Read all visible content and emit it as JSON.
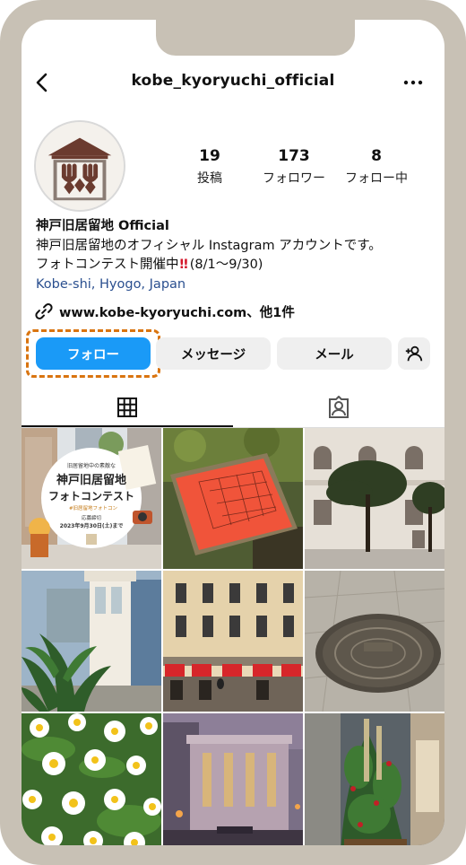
{
  "profile": {
    "username": "kobe_kyoryuchi_official",
    "display_name": "神戸旧居留地 Official",
    "bio_line1": "神戸旧居留地のオフィシャル Instagram アカウントです。",
    "bio_line2_pre": "フォトコンテスト開催中",
    "bio_line2_post": "(8/1～9/30)",
    "location": "Kobe-shi, Hyogo, Japan",
    "website": "www.kobe-kyoryuchi.com、他1件"
  },
  "stats": [
    {
      "value": "19",
      "label": "投稿"
    },
    {
      "value": "173",
      "label": "フォロワー"
    },
    {
      "value": "8",
      "label": "フォロー中"
    }
  ],
  "buttons": {
    "follow": "フォロー",
    "message": "メッセージ",
    "mail": "メール"
  },
  "posts": [
    {
      "caption_top": "旧居留地中の素敵な",
      "title1": "神戸旧居留地",
      "title2": "フォトコンテスト",
      "tag": "#旧居留地フォトコン",
      "deadline_label": "応募締切",
      "deadline": "2023年9月30日(土)まで"
    },
    {
      "subject": "map-plaque"
    },
    {
      "subject": "building-trees"
    },
    {
      "subject": "palm-kiosk"
    },
    {
      "subject": "street-awnings"
    },
    {
      "subject": "manhole"
    },
    {
      "subject": "daisies"
    },
    {
      "subject": "night-building"
    },
    {
      "subject": "kadomatsu"
    }
  ],
  "colors": {
    "follow_blue": "#1a9af7",
    "highlight_orange": "#d9740f",
    "link_blue": "#2a4f8f",
    "frame": "#c8c1b5"
  }
}
